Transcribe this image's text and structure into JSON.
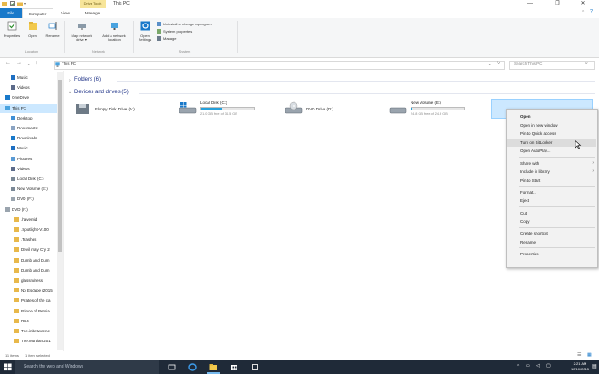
{
  "window": {
    "title": "This PC",
    "drive_tools": "Drive Tools",
    "min_glyph": "—",
    "max_glyph": "❐",
    "close_glyph": "✕"
  },
  "tabs": {
    "file": "File",
    "computer": "Computer",
    "view": "View",
    "manage": "Manage"
  },
  "ribbon": {
    "location": {
      "group": "Location",
      "properties": "Properties",
      "open": "Open",
      "rename": "Rename"
    },
    "network": {
      "group": "Network",
      "access_media": "Access\nmedia ▾",
      "map_network": "Map network\ndrive ▾",
      "add_location": "Add a network\nlocation"
    },
    "system": {
      "group": "System",
      "open_settings": "Open\nSettings",
      "uninstall": "Uninstall or change a program",
      "system_properties": "System properties",
      "manage": "Manage"
    }
  },
  "address": {
    "path": "This PC",
    "search_placeholder": "Search This PC"
  },
  "nav": {
    "items": [
      {
        "label": "Music",
        "icon": "music-icon",
        "indent": 12
      },
      {
        "label": "Videos",
        "icon": "video-icon",
        "indent": 12
      },
      {
        "label": "OneDrive",
        "icon": "cloud-icon",
        "indent": 6
      },
      {
        "label": "This PC",
        "icon": "computer-icon",
        "indent": 6,
        "selected": true
      },
      {
        "label": "Desktop",
        "icon": "folder-blue-icon",
        "indent": 12
      },
      {
        "label": "Documents",
        "icon": "document-icon",
        "indent": 12
      },
      {
        "label": "Downloads",
        "icon": "download-icon",
        "indent": 12
      },
      {
        "label": "Music",
        "icon": "music-icon",
        "indent": 12
      },
      {
        "label": "Pictures",
        "icon": "picture-icon",
        "indent": 12
      },
      {
        "label": "Videos",
        "icon": "video-icon",
        "indent": 12
      },
      {
        "label": "Local Disk (C:)",
        "icon": "drive-icon",
        "indent": 12
      },
      {
        "label": "New Volume (E:)",
        "icon": "drive-icon",
        "indent": 12
      },
      {
        "label": "DVD (F:)",
        "icon": "dvd-icon",
        "indent": 12
      },
      {
        "label": "DVD (F:)",
        "icon": "dvd-icon",
        "indent": 6
      },
      {
        "label": ".haventid",
        "icon": "folder-icon",
        "indent": 16
      },
      {
        "label": ".Spotlight-V100",
        "icon": "folder-icon",
        "indent": 16
      },
      {
        "label": ".Trashes",
        "icon": "folder-icon",
        "indent": 16
      },
      {
        "label": "Devil may Cry 2",
        "icon": "folder-icon",
        "indent": 16
      },
      {
        "label": "Dumb and Dum",
        "icon": "folder-icon",
        "indent": 16
      },
      {
        "label": "Dumb and Dum",
        "icon": "folder-icon",
        "indent": 16
      },
      {
        "label": "glassndress",
        "icon": "folder-icon",
        "indent": 16
      },
      {
        "label": "No Escape (2015",
        "icon": "folder-icon",
        "indent": 16
      },
      {
        "label": "Pirates of the ca",
        "icon": "folder-icon",
        "indent": 16
      },
      {
        "label": "Prince of Persia",
        "icon": "folder-icon",
        "indent": 16
      },
      {
        "label": "RS4",
        "icon": "folder-icon",
        "indent": 16
      },
      {
        "label": "The.inbetweene",
        "icon": "folder-icon",
        "indent": 16
      },
      {
        "label": "The.Martian.201",
        "icon": "folder-icon",
        "indent": 16
      }
    ]
  },
  "content": {
    "folders_header": "Folders (6)",
    "devices_header": "Devices and drives (5)",
    "drives": [
      {
        "name": "Floppy Disk Drive (A:)",
        "free": "",
        "fill": null,
        "icon": "floppy-icon"
      },
      {
        "name": "Local Disk (C:)",
        "free": "21.0 GB free of 34.5 GB",
        "fill": 0.39,
        "icon": "windows-drive-icon"
      },
      {
        "name": "DVD Drive (D:)",
        "free": "",
        "fill": null,
        "icon": "dvd-drive-icon"
      },
      {
        "name": "New Volume (E:)",
        "free": "24.8 GB free of 24.9 GB",
        "fill": 0.01,
        "icon": "hard-drive-icon"
      },
      {
        "name": "DVD (F:)",
        "free": "",
        "fill": 1.0,
        "icon": "dvd-drive-icon"
      }
    ]
  },
  "context_menu": {
    "items": [
      {
        "label": "Open",
        "bold": true
      },
      {
        "label": "Open in new window"
      },
      {
        "label": "Pin to Quick access"
      },
      {
        "label": "Turn on BitLocker",
        "hover": true
      },
      {
        "label": "Open AutoPlay..."
      },
      {
        "sep": true
      },
      {
        "label": "Share with",
        "submenu": true
      },
      {
        "label": "Include in library",
        "submenu": true
      },
      {
        "label": "Pin to Start"
      },
      {
        "sep": true
      },
      {
        "label": "Format..."
      },
      {
        "label": "Eject"
      },
      {
        "sep": true
      },
      {
        "label": "Cut"
      },
      {
        "label": "Copy"
      },
      {
        "sep": true
      },
      {
        "label": "Create shortcut"
      },
      {
        "label": "Rename"
      },
      {
        "sep": true
      },
      {
        "label": "Properties"
      }
    ]
  },
  "status": {
    "items": "11 items",
    "selected": "1 item selected"
  },
  "taskbar": {
    "search_placeholder": "Search the web and Windows",
    "time": "2:21 AM",
    "date": "12/10/2015"
  },
  "colors": {
    "accent": "#1979ca",
    "progress": "#26a0da",
    "full": "#da2626",
    "taskbar": "#1f2a38"
  }
}
